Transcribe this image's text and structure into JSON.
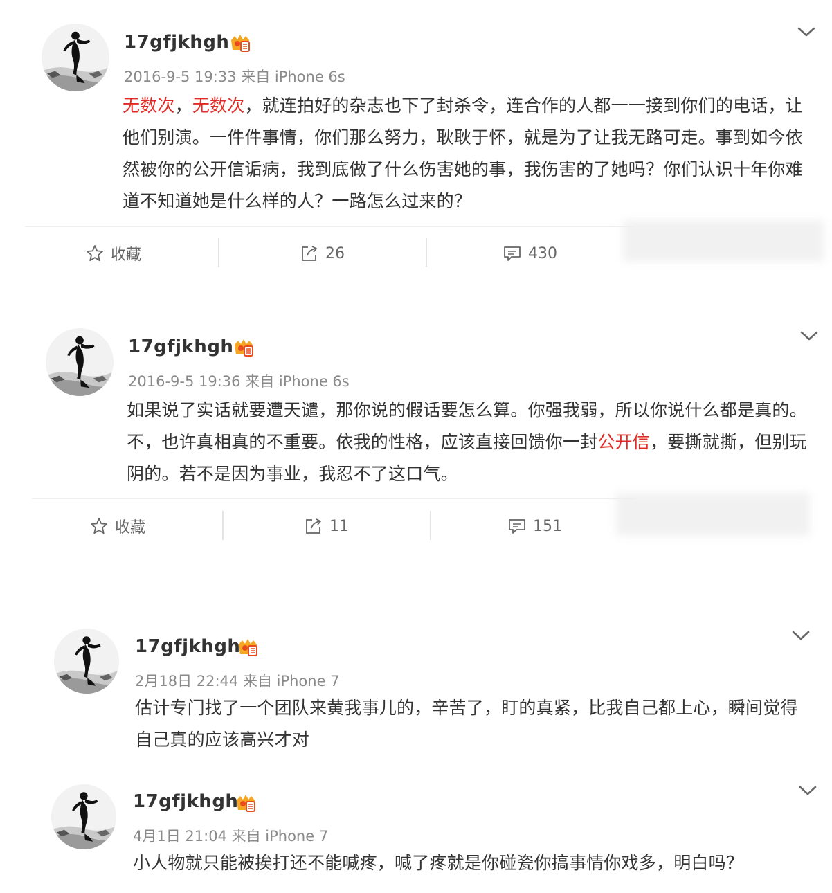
{
  "posts": [
    {
      "username": "17gfjkhgh",
      "meta": "2016-9-5 19:33 来自 iPhone 6s",
      "content": [
        {
          "text": "无数次",
          "red": true
        },
        {
          "text": "，",
          "red": false
        },
        {
          "text": "无数次",
          "red": true
        },
        {
          "text": "，就连拍好的杂志也下了封杀令，连合作的人都一一接到你们的电话，让他们别演。一件件事情，你们那么努力，耿耿于怀，就是为了让我无路可走。事到如今依然被你的公开信诟病，我到底做了什么伤害她的事，我伤害的了她吗？你们认识十年你难道不知道她是什么样的人？一路怎么过来的？",
          "red": false
        }
      ],
      "actions": {
        "favorite": "收藏",
        "repost": "26",
        "comment": "430"
      }
    },
    {
      "username": "17gfjkhgh",
      "meta": "2016-9-5 19:36 来自 iPhone 6s",
      "content": [
        {
          "text": "如果说了实话就要遭天谴，那你说的假话要怎么算。你强我弱，所以你说什么都是真的。不，也许真相真的不重要。依我的性格，应该直接回馈你一封",
          "red": false
        },
        {
          "text": "公开信",
          "red": true
        },
        {
          "text": "，要撕就撕，但别玩阴的。若不是因为事业，我忍不了这口气。",
          "red": false
        }
      ],
      "actions": {
        "favorite": "收藏",
        "repost": "11",
        "comment": "151"
      }
    },
    {
      "username": "17gfjkhgh",
      "meta": "2月18日 22:44 来自 iPhone 7",
      "content": [
        {
          "text": "估计专门找了一个团队来黄我事儿的，辛苦了，盯的真紧，比我自己都上心，瞬间觉得自己真的应该高兴才对",
          "red": false
        }
      ]
    },
    {
      "username": "17gfjkhgh",
      "meta": "4月1日 21:04 来自 iPhone 7",
      "content": [
        {
          "text": "小人物就只能被挨打还不能喊疼，喊了疼就是你碰瓷你搞事情你戏多，明白吗？",
          "red": false
        }
      ]
    }
  ],
  "icons": {
    "favorite": "star-outline-icon",
    "repost": "repost-icon",
    "comment": "comment-icon",
    "expand": "chevron-down-icon",
    "badge": "vip-crown-badge-icon"
  },
  "colors": {
    "highlight": "#e02a24",
    "text": "#333333",
    "meta": "#8a8a8a",
    "badge": "#f5a623"
  }
}
